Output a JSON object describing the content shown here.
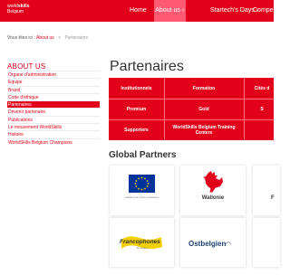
{
  "header": {
    "logo_line1": "world",
    "logo_line1_bold": "skills",
    "logo_line2": "Belgium",
    "nav": [
      "Home",
      "About us",
      "Startech's Days",
      "Compet"
    ]
  },
  "breadcrumb": {
    "prefix": "Vous êtes ici :",
    "link": "About us",
    "separator": ">",
    "current": "Partenaires"
  },
  "sidebar": {
    "title": "ABOUT US",
    "items": [
      {
        "label": "Organe d'administration",
        "active": false
      },
      {
        "label": "Equipe",
        "active": false
      },
      {
        "label": "Brand",
        "active": false
      },
      {
        "label": "Code d'éthique",
        "active": false
      },
      {
        "label": "Partenaires",
        "active": true
      },
      {
        "label": "Devenir partenaire",
        "active": false
      },
      {
        "label": "Publications",
        "active": false
      },
      {
        "label": "Le mouvement WorldSkills",
        "active": false
      },
      {
        "label": "Histoire",
        "active": false
      },
      {
        "label": "WorldSkills Belgium Champions",
        "active": false
      }
    ]
  },
  "main": {
    "title": "Partenaires",
    "table": {
      "rows": [
        [
          "Institutionnels",
          "Formation",
          "Cités d"
        ],
        [
          "Premium",
          "Gold",
          "S"
        ],
        [
          "Supporters",
          "WorldSkills Belgium Training Centers",
          ""
        ]
      ]
    },
    "global_partners_title": "Global Partners",
    "partners": [
      {
        "name": "European Union",
        "caption": "Cofinancé par l'Union européenne"
      },
      {
        "name": "Wallonie"
      },
      {
        "name": "F"
      },
      {
        "name": "Francophones",
        "sub": "Bruxelles"
      },
      {
        "name": "Ostbelgien"
      },
      {
        "name": ""
      }
    ]
  },
  "colors": {
    "brand_red": "#e2001a",
    "nav_active": "#ff5a73"
  }
}
